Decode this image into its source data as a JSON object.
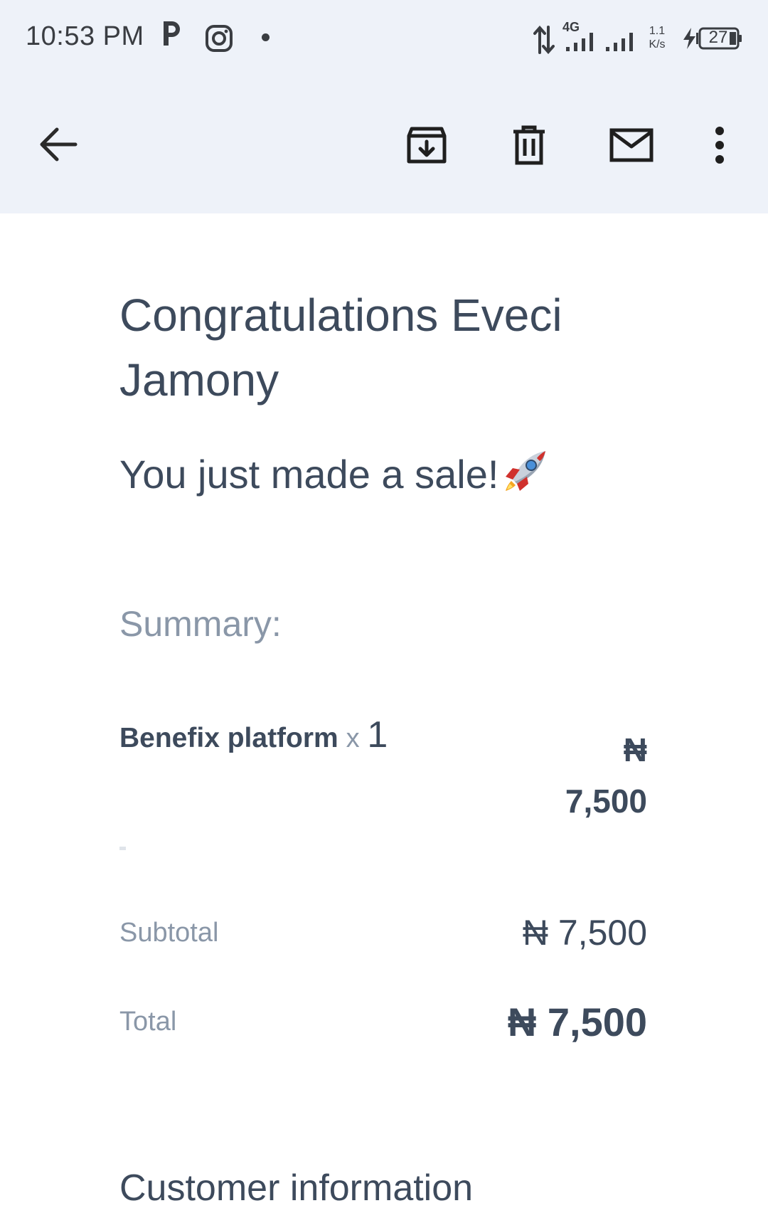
{
  "status_bar": {
    "time": "10:53 PM",
    "network_type": "4G",
    "net_speed_value": "1.1",
    "net_speed_unit": "K/s",
    "battery_level": "27",
    "icons": [
      "parking-app-icon",
      "instagram-icon",
      "notification-dot-icon",
      "data-transfer-icon",
      "signal-icon",
      "signal-icon-2",
      "charging-icon",
      "battery-icon"
    ]
  },
  "toolbar": {
    "icons": [
      "back-arrow-icon",
      "archive-icon",
      "delete-icon",
      "mark-unread-icon",
      "more-options-icon"
    ]
  },
  "email": {
    "heading": "Congratulations Eveci Jamony",
    "subheading": "You just made a sale!",
    "summary_label": "Summary:",
    "item": {
      "name": "Benefix platform",
      "multiplier": "x",
      "quantity": "1",
      "currency": "₦",
      "price": "7,500",
      "description": "-"
    },
    "subtotal": {
      "label": "Subtotal",
      "value": "₦ 7,500"
    },
    "total": {
      "label": "Total",
      "value": "₦ 7,500"
    },
    "customer_heading": "Customer information"
  },
  "colors": {
    "app_bar_bg": "#eef2f9",
    "text_primary": "#3d4a5c",
    "text_muted": "#8a97a8",
    "icon_dark": "#1f1f1f"
  }
}
